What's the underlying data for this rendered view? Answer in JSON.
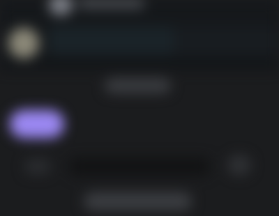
{
  "colors": {
    "background": "#1b1c1e",
    "header_background": "#15181b",
    "accent": "#9b88f2",
    "input_background": "#121314"
  },
  "header": {
    "avatar_icon": "user-avatar-icon"
  },
  "conversation": {
    "contact_avatar_icon": "user-avatar-icon"
  },
  "composer": {
    "attach_icon": "attachment-icon",
    "send_icon": "send-icon"
  }
}
